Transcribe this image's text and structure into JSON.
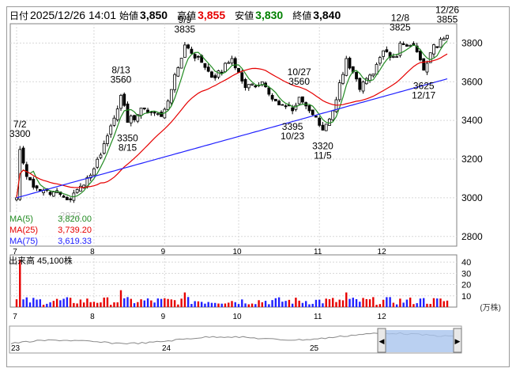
{
  "header": {
    "date_label": "日付",
    "datetime": "2025/12/26 14:01",
    "open_label": "始値",
    "open": "3,850",
    "high_label": "高値",
    "high": "3,855",
    "low_label": "安値",
    "low": "3,830",
    "close_label": "終値",
    "close": "3,840",
    "colors": {
      "high": "#e60000",
      "low": "#008000",
      "text": "#000000"
    }
  },
  "legend": [
    {
      "name": "MA(5)",
      "value": "3,820.00",
      "color": "#228b22"
    },
    {
      "name": "MA(25)",
      "value": "3,739.20",
      "color": "#e60000"
    },
    {
      "name": "MA(75)",
      "value": "3,619.33",
      "color": "#2020ff"
    }
  ],
  "volume_label": "出来高  45,100株",
  "volume_unit": "(万株)",
  "navigator_ticks": [
    "23",
    "24",
    "25"
  ],
  "chart_data": [
    {
      "type": "candlestick",
      "x_ticks": [
        "7",
        "8",
        "9",
        "10",
        "11",
        "12"
      ],
      "y_ticks": [
        2800,
        3000,
        3200,
        3400,
        3600,
        3800
      ],
      "ylim": [
        2750,
        3900
      ],
      "grid": true,
      "tick_dates": [
        "2025-07-01",
        "2025-08-01",
        "2025-09-01",
        "2025-10-01",
        "2025-11-04",
        "2025-12-01"
      ],
      "start": "2025-07-01",
      "end": "2025-12-26",
      "anchors": [
        [
          "2025-07-01",
          3000
        ],
        [
          "2025-07-02",
          3250
        ],
        [
          "2025-07-04",
          3110
        ],
        [
          "2025-07-09",
          3050
        ],
        [
          "2025-07-16",
          3030
        ],
        [
          "2025-07-23",
          2990
        ],
        [
          "2025-07-28",
          3060
        ],
        [
          "2025-08-01",
          3150
        ],
        [
          "2025-08-07",
          3320
        ],
        [
          "2025-08-13",
          3530
        ],
        [
          "2025-08-15",
          3390
        ],
        [
          "2025-08-22",
          3460
        ],
        [
          "2025-08-29",
          3420
        ],
        [
          "2025-09-03",
          3560
        ],
        [
          "2025-09-09",
          3790
        ],
        [
          "2025-09-16",
          3700
        ],
        [
          "2025-09-22",
          3620
        ],
        [
          "2025-09-29",
          3720
        ],
        [
          "2025-10-03",
          3570
        ],
        [
          "2025-10-10",
          3600
        ],
        [
          "2025-10-17",
          3480
        ],
        [
          "2025-10-23",
          3450
        ],
        [
          "2025-10-27",
          3520
        ],
        [
          "2025-10-31",
          3430
        ],
        [
          "2025-11-05",
          3350
        ],
        [
          "2025-11-10",
          3450
        ],
        [
          "2025-11-14",
          3720
        ],
        [
          "2025-11-20",
          3560
        ],
        [
          "2025-11-26",
          3640
        ],
        [
          "2025-12-01",
          3760
        ],
        [
          "2025-12-05",
          3730
        ],
        [
          "2025-12-08",
          3800
        ],
        [
          "2025-12-12",
          3790
        ],
        [
          "2025-12-17",
          3660
        ],
        [
          "2025-12-19",
          3750
        ],
        [
          "2025-12-24",
          3820
        ],
        [
          "2025-12-26",
          3840
        ]
      ],
      "series": [
        {
          "name": "MA(5)",
          "period": 5,
          "color": "#228b22"
        },
        {
          "name": "MA(25)",
          "period": 25,
          "color": "#e60000"
        },
        {
          "name": "MA(75)",
          "period": 75,
          "color": "#2020ff"
        }
      ],
      "annotations": [
        {
          "date": "2025-07-02",
          "label": "7/2",
          "value": "3300",
          "pos": "above"
        },
        {
          "date": "2025-07-23",
          "label": "",
          "value": "2972",
          "pos": "below"
        },
        {
          "date": "2025-08-13",
          "label": "8/13",
          "value": "3560",
          "pos": "above"
        },
        {
          "date": "2025-08-15",
          "label": "8/15",
          "value": "3350",
          "pos": "below"
        },
        {
          "date": "2025-09-09",
          "label": "9/9",
          "value": "3835",
          "pos": "above"
        },
        {
          "date": "2025-10-27",
          "label": "10/27",
          "value": "3560",
          "pos": "above"
        },
        {
          "date": "2025-10-23",
          "label": "10/23",
          "value": "3395",
          "pos": "below"
        },
        {
          "date": "2025-11-05",
          "label": "11/5",
          "value": "3320",
          "pos": "below"
        },
        {
          "date": "2025-12-08",
          "label": "12/8",
          "value": "3825",
          "pos": "above"
        },
        {
          "date": "2025-12-17",
          "label": "12/17",
          "value": "3625",
          "pos": "below"
        },
        {
          "date": "2025-12-26",
          "label": "12/26",
          "value": "3855",
          "pos": "above"
        }
      ]
    },
    {
      "type": "bar",
      "title": "出来高",
      "y_ticks": [
        10,
        20,
        30,
        40
      ],
      "ylim": [
        0,
        45
      ],
      "unit": "(万株)",
      "colors": {
        "up": "#e60000",
        "down": "#2020ff"
      },
      "spikes": [
        [
          "2025-07-02",
          42
        ],
        [
          "2025-08-13",
          15
        ],
        [
          "2025-09-09",
          13
        ],
        [
          "2025-11-14",
          13
        ],
        [
          "2025-12-17",
          8
        ]
      ]
    }
  ]
}
